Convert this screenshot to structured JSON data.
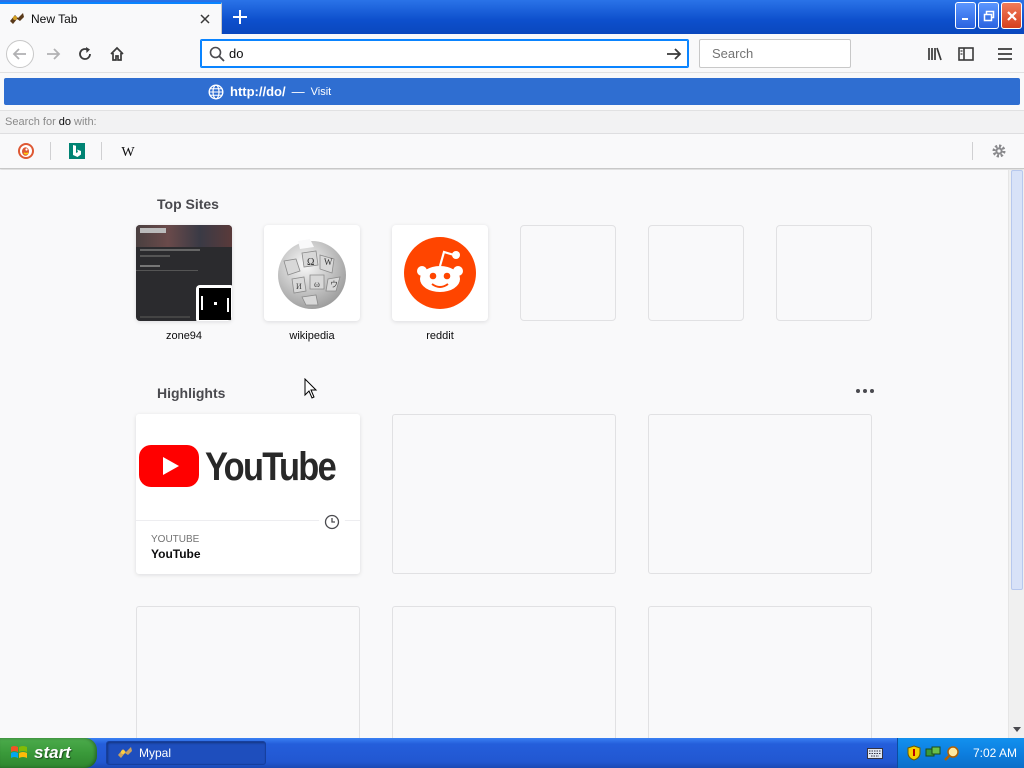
{
  "browser": {
    "tab": {
      "title": "New Tab"
    },
    "urlbar": {
      "value": "do"
    },
    "searchbar": {
      "placeholder": "Search"
    }
  },
  "dropdown": {
    "url_prefix": "http://",
    "url_bold": "do",
    "url_suffix": "/",
    "separator": "—",
    "action": "Visit",
    "search_with_prefix": "Search for",
    "search_with_term": "do",
    "search_with_suffix": "with:",
    "engines": [
      "duckduckgo-icon",
      "bing-icon",
      "wikipedia-icon"
    ]
  },
  "newtab": {
    "top_sites_title": "Top Sites",
    "top_sites": [
      {
        "label": "zone94"
      },
      {
        "label": "wikipedia"
      },
      {
        "label": "reddit"
      },
      {
        "label": ""
      },
      {
        "label": ""
      },
      {
        "label": ""
      }
    ],
    "highlights_title": "Highlights",
    "highlight": {
      "brand": "YouTube",
      "source": "YOUTUBE",
      "title": "YouTube"
    }
  },
  "taskbar": {
    "start_label": "start",
    "task_label": "Mypal",
    "time": "7:02 AM"
  },
  "colors": {
    "accent": "#0a84ff",
    "suggest_bg": "#2f6ed1",
    "youtube_red": "#ff0000",
    "reddit_orange": "#ff4500"
  }
}
